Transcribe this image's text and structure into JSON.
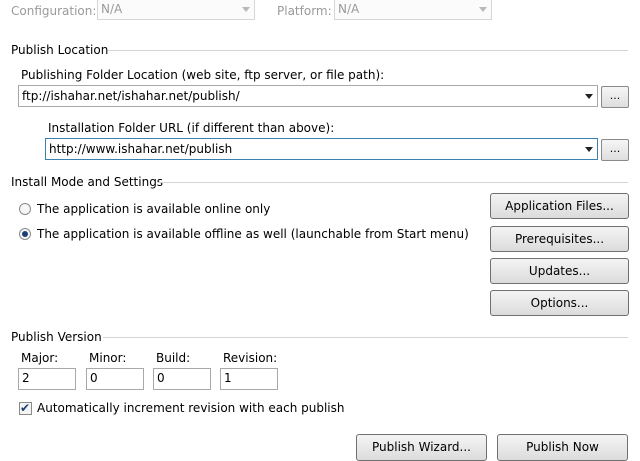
{
  "top": {
    "configuration_label": "Configuration:",
    "configuration_value": "N/A",
    "platform_label": "Platform:",
    "platform_value": "N/A"
  },
  "publish_location": {
    "title": "Publish Location",
    "folder_label": "Publishing Folder Location (web site, ftp server, or file path):",
    "folder_value": "ftp://ishahar.net/ishahar.net/publish/",
    "install_label": "Installation Folder URL (if different than above):",
    "install_value": "http://www.ishahar.net/publish",
    "browse_label": "..."
  },
  "install_mode": {
    "title": "Install Mode and Settings",
    "options": [
      {
        "label": "The application is available online only",
        "selected": false
      },
      {
        "label": "The application is available offline as well (launchable from Start menu)",
        "selected": true
      }
    ],
    "buttons": {
      "application_files": "Application Files...",
      "prerequisites": "Prerequisites...",
      "updates": "Updates...",
      "options": "Options..."
    }
  },
  "publish_version": {
    "title": "Publish Version",
    "major_label": "Major:",
    "minor_label": "Minor:",
    "build_label": "Build:",
    "revision_label": "Revision:",
    "major": "2",
    "minor": "0",
    "build": "0",
    "revision": "1",
    "auto_increment_label": "Automatically increment revision with each publish",
    "auto_increment": true
  },
  "footer": {
    "wizard_label": "Publish Wizard...",
    "publish_now_label": "Publish Now"
  }
}
